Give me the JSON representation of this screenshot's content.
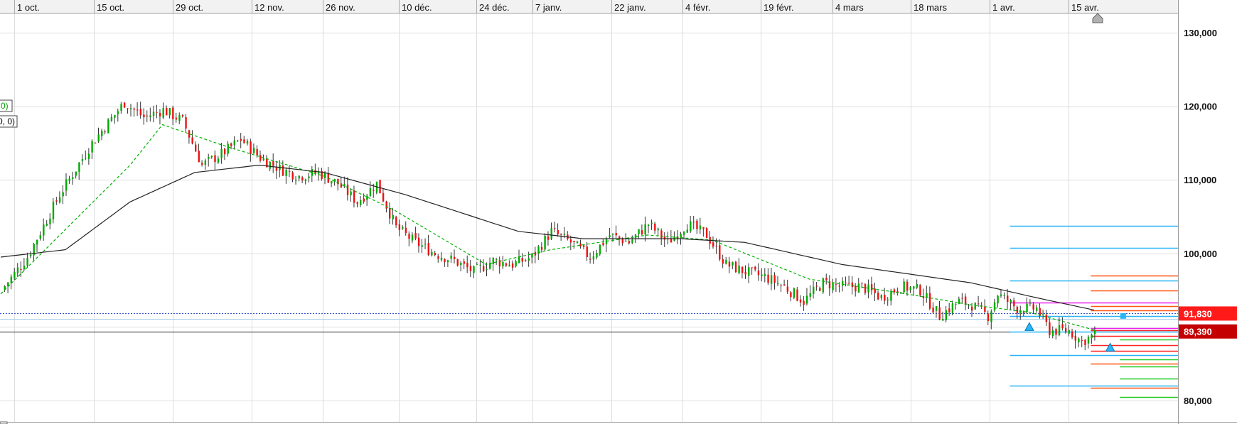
{
  "chart_data": {
    "type": "candlestick",
    "title": "",
    "x_tick_labels": [
      "1 oct.",
      "15 oct.",
      "29 oct.",
      "12 nov.",
      "26 nov.",
      "10 déc.",
      "24 déc.",
      "7 janv.",
      "22 janv.",
      "4 févr.",
      "19 févr.",
      "4 mars",
      "18 mars",
      "1 avr.",
      "15 avr."
    ],
    "y_tick_labels": [
      "130,000",
      "120,000",
      "110,000",
      "100,000",
      "80,000"
    ],
    "y_ticks": [
      130000,
      120000,
      110000,
      100000,
      90000,
      80000
    ],
    "ylim": [
      77000,
      133000
    ],
    "price_labels": [
      {
        "text": "91,830",
        "value": 91830,
        "color": "#ff1a1a"
      },
      {
        "text": "89,390",
        "value": 89390,
        "color": "#c40000"
      }
    ],
    "legend_fragments": [
      {
        "text": "0)",
        "color": "#00a000"
      },
      {
        "text": "0, 0)",
        "color": "#000000"
      }
    ],
    "close_anchors": [
      [
        0,
        95000
      ],
      [
        8,
        99500
      ],
      [
        18,
        108000
      ],
      [
        28,
        115000
      ],
      [
        38,
        120500
      ],
      [
        44,
        118500
      ],
      [
        50,
        119500
      ],
      [
        56,
        118000
      ],
      [
        62,
        112000
      ],
      [
        68,
        113500
      ],
      [
        74,
        115500
      ],
      [
        80,
        113000
      ],
      [
        86,
        111500
      ],
      [
        92,
        110500
      ],
      [
        98,
        111000
      ],
      [
        104,
        109500
      ],
      [
        110,
        107000
      ],
      [
        116,
        109500
      ],
      [
        122,
        103500
      ],
      [
        128,
        101500
      ],
      [
        134,
        100000
      ],
      [
        140,
        99000
      ],
      [
        146,
        97500
      ],
      [
        152,
        99000
      ],
      [
        158,
        98500
      ],
      [
        164,
        99500
      ],
      [
        170,
        103000
      ],
      [
        176,
        101500
      ],
      [
        182,
        99500
      ],
      [
        188,
        102500
      ],
      [
        194,
        101500
      ],
      [
        200,
        104000
      ],
      [
        206,
        101500
      ],
      [
        212,
        104000
      ],
      [
        218,
        102500
      ],
      [
        224,
        98500
      ],
      [
        230,
        97500
      ],
      [
        236,
        96800
      ],
      [
        242,
        95500
      ],
      [
        248,
        93500
      ],
      [
        254,
        96000
      ],
      [
        260,
        95500
      ],
      [
        266,
        95500
      ],
      [
        272,
        94000
      ],
      [
        278,
        95500
      ],
      [
        284,
        95000
      ],
      [
        290,
        91500
      ],
      [
        296,
        93500
      ],
      [
        300,
        93000
      ],
      [
        305,
        91500
      ],
      [
        308,
        94500
      ],
      [
        314,
        92500
      ],
      [
        320,
        92500
      ],
      [
        324,
        89500
      ],
      [
        330,
        89500
      ],
      [
        334,
        88000
      ],
      [
        338,
        89000
      ]
    ],
    "series": [
      {
        "name": "",
        "kind": "moving-average-short",
        "color": "#00b000",
        "style": "dashed",
        "anchors": [
          [
            0,
            94500
          ],
          [
            40,
            112000
          ],
          [
            50,
            117500
          ],
          [
            60,
            116000
          ],
          [
            70,
            114500
          ],
          [
            100,
            110500
          ],
          [
            122,
            105800
          ],
          [
            150,
            98500
          ],
          [
            170,
            100500
          ],
          [
            200,
            102500
          ],
          [
            220,
            101800
          ],
          [
            250,
            96500
          ],
          [
            280,
            94500
          ],
          [
            300,
            93000
          ],
          [
            318,
            92000
          ],
          [
            338,
            89600
          ]
        ]
      },
      {
        "name": "",
        "kind": "moving-average-long",
        "color": "#222222",
        "style": "solid",
        "anchors": [
          [
            0,
            99500
          ],
          [
            20,
            100500
          ],
          [
            40,
            107000
          ],
          [
            60,
            111000
          ],
          [
            80,
            112000
          ],
          [
            100,
            111000
          ],
          [
            125,
            108000
          ],
          [
            160,
            103000
          ],
          [
            180,
            102000
          ],
          [
            210,
            102000
          ],
          [
            230,
            101500
          ],
          [
            260,
            98500
          ],
          [
            300,
            96000
          ],
          [
            320,
            94000
          ],
          [
            338,
            92300
          ]
        ]
      }
    ],
    "horizontal_levels": [
      {
        "value": 103700,
        "color": "#29b6f6",
        "from": 312
      },
      {
        "value": 100800,
        "color": "#29b6f6",
        "from": 312
      },
      {
        "value": 96300,
        "color": "#29b6f6",
        "from": 312
      },
      {
        "value": 93300,
        "color": "#ee22ee",
        "from": 312
      },
      {
        "value": 91500,
        "color": "#29b6f6",
        "from": 312
      },
      {
        "value": 89400,
        "color": "#29b6f6",
        "from": 312
      },
      {
        "value": 86200,
        "color": "#29b6f6",
        "from": 312
      },
      {
        "value": 82000,
        "color": "#29b6f6",
        "from": 312
      },
      {
        "value": 97000,
        "color": "#ff5511",
        "from": 337
      },
      {
        "value": 95000,
        "color": "#ff5511",
        "from": 337
      },
      {
        "value": 92800,
        "color": "#ff5511",
        "from": 337
      },
      {
        "value": 92300,
        "color": "#ff5511",
        "from": 337
      },
      {
        "value": 89800,
        "color": "#ee22ee",
        "from": 337
      },
      {
        "value": 89600,
        "color": "#ff2222",
        "from": 337
      },
      {
        "value": 88800,
        "color": "#ff2222",
        "from": 337
      },
      {
        "value": 87500,
        "color": "#ff2222",
        "from": 337
      },
      {
        "value": 86800,
        "color": "#ff2222",
        "from": 337
      },
      {
        "value": 85000,
        "color": "#ff5511",
        "from": 337
      },
      {
        "value": 81700,
        "color": "#ff5511",
        "from": 337
      },
      {
        "value": 88300,
        "color": "#22cc22",
        "from": 346
      },
      {
        "value": 85600,
        "color": "#22cc22",
        "from": 346
      },
      {
        "value": 84600,
        "color": "#22cc22",
        "from": 346
      },
      {
        "value": 83000,
        "color": "#22cc22",
        "from": 346
      },
      {
        "value": 80500,
        "color": "#22cc22",
        "from": 346
      }
    ],
    "reference_lines": [
      {
        "value": 91830,
        "color": "#3355cc",
        "style": "dotted"
      },
      {
        "value": 91100,
        "color": "#a8d0e8",
        "style": "solid"
      },
      {
        "value": 89400,
        "color": "#222222",
        "style": "solid"
      }
    ],
    "markers": [
      {
        "x": 318,
        "value": 90000,
        "color": "#29b6f6",
        "shape": "up-arrow"
      },
      {
        "x": 343,
        "value": 87200,
        "color": "#29b6f6",
        "shape": "up-arrow"
      },
      {
        "x": 347,
        "value": 91500,
        "color": "#29b6f6",
        "shape": "square"
      }
    ],
    "colors": {
      "up": "#00aa00",
      "down": "#ee1111",
      "grid": "#dddddd"
    },
    "grid": true
  }
}
